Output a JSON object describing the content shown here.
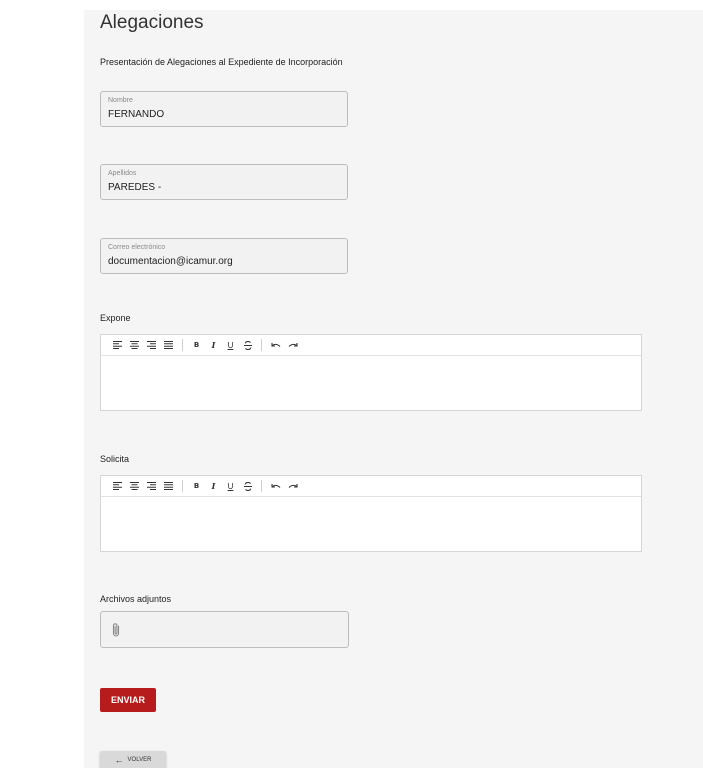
{
  "page": {
    "title": "Alegaciones",
    "subtitle": "Presentación de Alegaciones al Expediente de Incorporación"
  },
  "fields": {
    "nombre": {
      "label": "Nombre",
      "value": "FERNANDO"
    },
    "apellidos": {
      "label": "Apellidos",
      "value": "PAREDES -"
    },
    "correo": {
      "label": "Correo electrónico",
      "value": "documentacion@icamur.org"
    }
  },
  "editors": {
    "expone": {
      "label": "Expone",
      "content": ""
    },
    "solicita": {
      "label": "Solicita",
      "content": ""
    }
  },
  "toolbar": {
    "bold": "B",
    "italic": "I",
    "underline": "U",
    "strike": "S",
    "icons": [
      "align-left-icon",
      "align-center-icon",
      "align-right-icon",
      "align-justify-icon",
      "bold-icon",
      "italic-icon",
      "underline-icon",
      "strikethrough-icon",
      "undo-icon",
      "redo-icon"
    ]
  },
  "attachments": {
    "label": "Archivos adjuntos",
    "icon": "paperclip-icon"
  },
  "actions": {
    "send_label": "ENVIAR",
    "back_label": "VOLVER",
    "send_color": "#b71c1c"
  }
}
